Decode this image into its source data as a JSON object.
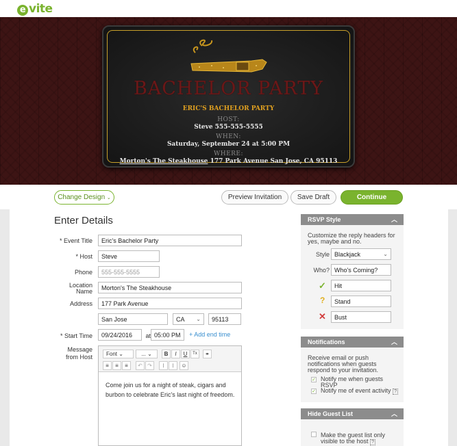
{
  "brand": {
    "logo_text": "vite",
    "logo_mark": "e"
  },
  "invitation": {
    "title": "BACHELOR PARTY",
    "subtitle": "ERIC'S BACHELOR PARTY",
    "host_label": "HOST:",
    "host_value": "Steve 555-555-5555",
    "when_label": "WHEN:",
    "when_value": "Saturday, September 24 at 5:00 PM",
    "where_label": "WHERE:",
    "where_name": "Morton's The Steakhouse",
    "where_address": "177 Park Avenue San Jose, CA 95113"
  },
  "actions": {
    "change_design": "Change Design",
    "preview": "Preview Invitation",
    "save_draft": "Save Draft",
    "continue": "Continue"
  },
  "form": {
    "heading": "Enter Details",
    "event_title_label": "* Event Title",
    "event_title_value": "Eric's Bachelor Party",
    "host_label": "* Host",
    "host_value": "Steve",
    "phone_label": "Phone",
    "phone_placeholder": "555-555-5555",
    "location_label": "Location Name",
    "location_value": "Morton's The Steakhouse",
    "address_label": "Address",
    "address_value": "177 Park Avenue",
    "city_value": "San Jose",
    "state_value": "CA",
    "zip_value": "95113",
    "start_time_label": "* Start Time",
    "date_value": "09/24/2016",
    "at_text": "at",
    "time_value": "05:00 PM",
    "add_end_time": "+ Add end time",
    "message_label": "Message from Host",
    "message_text": "Come join us for a night of steak, cigars and burbon to celebrate Eric's last night of freedom.",
    "toolbar": {
      "font": "Font",
      "size": "...",
      "bold": "B",
      "italic": "I",
      "underline": "U",
      "clear": "Tx"
    }
  },
  "rsvp": {
    "header": "RSVP Style",
    "description": "Customize the reply headers for yes, maybe and no.",
    "style_label": "Style",
    "style_value": "Blackjack",
    "who_label": "Who?",
    "who_value": "Who's Coming?",
    "yes_value": "Hit",
    "maybe_value": "Stand",
    "no_value": "Bust",
    "colors": {
      "yes": "#7ab32e",
      "maybe": "#e0b020",
      "no": "#d23c3c"
    }
  },
  "notifications": {
    "header": "Notifications",
    "description": "Receive email or push notifications when guests respond to your invitation.",
    "option1": "Notify me when guests RSVP",
    "option2": "Notify me of event activity",
    "help": "?"
  },
  "guest_list": {
    "header": "Hide Guest List",
    "option": "Make the guest list only visible to the host",
    "help": "?"
  }
}
